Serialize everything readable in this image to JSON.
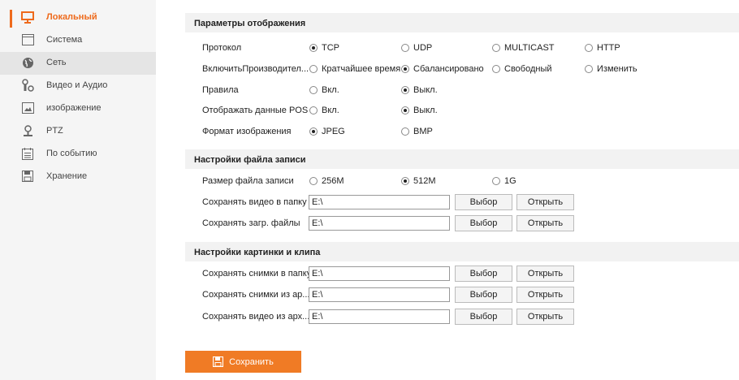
{
  "sidebar": {
    "items": [
      {
        "label": "Локальный",
        "icon": "monitor-icon"
      },
      {
        "label": "Система",
        "icon": "window-icon"
      },
      {
        "label": "Сеть",
        "icon": "globe-icon"
      },
      {
        "label": "Видео и Аудио",
        "icon": "video-audio-icon"
      },
      {
        "label": "изображение",
        "icon": "image-icon"
      },
      {
        "label": "PTZ",
        "icon": "ptz-camera-icon"
      },
      {
        "label": "По событию",
        "icon": "event-calendar-icon"
      },
      {
        "label": "Хранение",
        "icon": "floppy-disk-icon"
      }
    ],
    "active_color": "#ee6a1c"
  },
  "display": {
    "header": "Параметры отображения",
    "protocol": {
      "label": "Протокол",
      "options": [
        "TCP",
        "UDP",
        "MULTICAST",
        "HTTP"
      ],
      "selected": "TCP"
    },
    "performance": {
      "label": "ВключитьПроизводител...",
      "options": [
        "Кратчайшее время",
        "Сбалансировано",
        "Свободный",
        "Изменить"
      ],
      "selected": "Сбалансировано"
    },
    "rules": {
      "label": "Правила",
      "options": [
        "Вкл.",
        "Выкл."
      ],
      "selected": "Выкл."
    },
    "pos": {
      "label": "Отображать данные POS",
      "options": [
        "Вкл.",
        "Выкл."
      ],
      "selected": "Выкл."
    },
    "format": {
      "label": "Формат изображения",
      "options": [
        "JPEG",
        "BMP"
      ],
      "selected": "JPEG"
    }
  },
  "record": {
    "header": "Настройки файла записи",
    "size": {
      "label": "Размер файла записи",
      "options": [
        "256M",
        "512M",
        "1G"
      ],
      "selected": "512M"
    },
    "video_path": {
      "label": "Сохранять видео в папку",
      "value": "E:\\"
    },
    "download_path": {
      "label": "Сохранять загр. файлы",
      "value": "E:\\"
    }
  },
  "clip": {
    "header": "Настройки картинки и клипа",
    "snap_path": {
      "label": "Сохранять снимки в папку",
      "value": "E:\\"
    },
    "snap_archive_path": {
      "label": "Сохранять снимки из ар...",
      "value": "E:\\"
    },
    "video_archive_path": {
      "label": "Сохранять видео из арх...",
      "value": "E:\\"
    }
  },
  "buttons": {
    "choose": "Выбор",
    "open": "Открыть",
    "save": "Сохранить"
  },
  "colors": {
    "accent": "#f07b25"
  }
}
